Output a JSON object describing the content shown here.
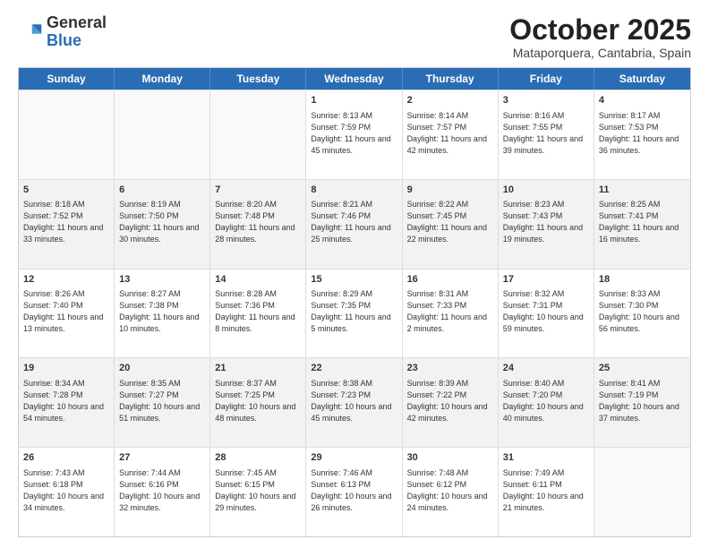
{
  "logo": {
    "general": "General",
    "blue": "Blue"
  },
  "header": {
    "month": "October 2025",
    "location": "Mataporquera, Cantabria, Spain"
  },
  "days": [
    "Sunday",
    "Monday",
    "Tuesday",
    "Wednesday",
    "Thursday",
    "Friday",
    "Saturday"
  ],
  "rows": [
    [
      {
        "day": "",
        "empty": true
      },
      {
        "day": "",
        "empty": true
      },
      {
        "day": "",
        "empty": true
      },
      {
        "day": "1",
        "sunrise": "8:13 AM",
        "sunset": "7:59 PM",
        "daylight": "11 hours and 45 minutes."
      },
      {
        "day": "2",
        "sunrise": "8:14 AM",
        "sunset": "7:57 PM",
        "daylight": "11 hours and 42 minutes."
      },
      {
        "day": "3",
        "sunrise": "8:16 AM",
        "sunset": "7:55 PM",
        "daylight": "11 hours and 39 minutes."
      },
      {
        "day": "4",
        "sunrise": "8:17 AM",
        "sunset": "7:53 PM",
        "daylight": "11 hours and 36 minutes."
      }
    ],
    [
      {
        "day": "5",
        "sunrise": "8:18 AM",
        "sunset": "7:52 PM",
        "daylight": "11 hours and 33 minutes."
      },
      {
        "day": "6",
        "sunrise": "8:19 AM",
        "sunset": "7:50 PM",
        "daylight": "11 hours and 30 minutes."
      },
      {
        "day": "7",
        "sunrise": "8:20 AM",
        "sunset": "7:48 PM",
        "daylight": "11 hours and 28 minutes."
      },
      {
        "day": "8",
        "sunrise": "8:21 AM",
        "sunset": "7:46 PM",
        "daylight": "11 hours and 25 minutes."
      },
      {
        "day": "9",
        "sunrise": "8:22 AM",
        "sunset": "7:45 PM",
        "daylight": "11 hours and 22 minutes."
      },
      {
        "day": "10",
        "sunrise": "8:23 AM",
        "sunset": "7:43 PM",
        "daylight": "11 hours and 19 minutes."
      },
      {
        "day": "11",
        "sunrise": "8:25 AM",
        "sunset": "7:41 PM",
        "daylight": "11 hours and 16 minutes."
      }
    ],
    [
      {
        "day": "12",
        "sunrise": "8:26 AM",
        "sunset": "7:40 PM",
        "daylight": "11 hours and 13 minutes."
      },
      {
        "day": "13",
        "sunrise": "8:27 AM",
        "sunset": "7:38 PM",
        "daylight": "11 hours and 10 minutes."
      },
      {
        "day": "14",
        "sunrise": "8:28 AM",
        "sunset": "7:36 PM",
        "daylight": "11 hours and 8 minutes."
      },
      {
        "day": "15",
        "sunrise": "8:29 AM",
        "sunset": "7:35 PM",
        "daylight": "11 hours and 5 minutes."
      },
      {
        "day": "16",
        "sunrise": "8:31 AM",
        "sunset": "7:33 PM",
        "daylight": "11 hours and 2 minutes."
      },
      {
        "day": "17",
        "sunrise": "8:32 AM",
        "sunset": "7:31 PM",
        "daylight": "10 hours and 59 minutes."
      },
      {
        "day": "18",
        "sunrise": "8:33 AM",
        "sunset": "7:30 PM",
        "daylight": "10 hours and 56 minutes."
      }
    ],
    [
      {
        "day": "19",
        "sunrise": "8:34 AM",
        "sunset": "7:28 PM",
        "daylight": "10 hours and 54 minutes."
      },
      {
        "day": "20",
        "sunrise": "8:35 AM",
        "sunset": "7:27 PM",
        "daylight": "10 hours and 51 minutes."
      },
      {
        "day": "21",
        "sunrise": "8:37 AM",
        "sunset": "7:25 PM",
        "daylight": "10 hours and 48 minutes."
      },
      {
        "day": "22",
        "sunrise": "8:38 AM",
        "sunset": "7:23 PM",
        "daylight": "10 hours and 45 minutes."
      },
      {
        "day": "23",
        "sunrise": "8:39 AM",
        "sunset": "7:22 PM",
        "daylight": "10 hours and 42 minutes."
      },
      {
        "day": "24",
        "sunrise": "8:40 AM",
        "sunset": "7:20 PM",
        "daylight": "10 hours and 40 minutes."
      },
      {
        "day": "25",
        "sunrise": "8:41 AM",
        "sunset": "7:19 PM",
        "daylight": "10 hours and 37 minutes."
      }
    ],
    [
      {
        "day": "26",
        "sunrise": "7:43 AM",
        "sunset": "6:18 PM",
        "daylight": "10 hours and 34 minutes."
      },
      {
        "day": "27",
        "sunrise": "7:44 AM",
        "sunset": "6:16 PM",
        "daylight": "10 hours and 32 minutes."
      },
      {
        "day": "28",
        "sunrise": "7:45 AM",
        "sunset": "6:15 PM",
        "daylight": "10 hours and 29 minutes."
      },
      {
        "day": "29",
        "sunrise": "7:46 AM",
        "sunset": "6:13 PM",
        "daylight": "10 hours and 26 minutes."
      },
      {
        "day": "30",
        "sunrise": "7:48 AM",
        "sunset": "6:12 PM",
        "daylight": "10 hours and 24 minutes."
      },
      {
        "day": "31",
        "sunrise": "7:49 AM",
        "sunset": "6:11 PM",
        "daylight": "10 hours and 21 minutes."
      },
      {
        "day": "",
        "empty": true
      }
    ]
  ]
}
